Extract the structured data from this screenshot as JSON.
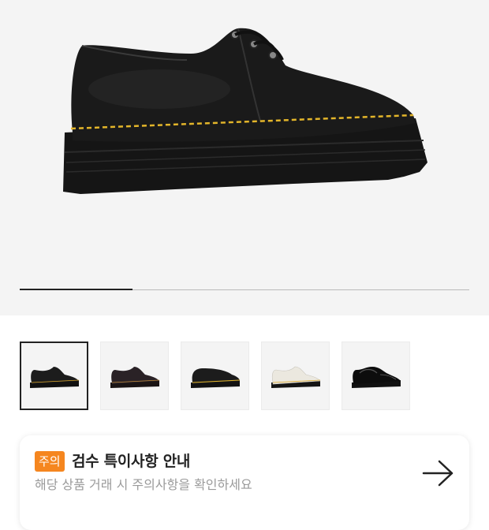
{
  "product": {
    "image_icon": "black-platform-derby-shoe",
    "gallery_progress": 0.25
  },
  "thumbnails": [
    {
      "icon": "black-shoe-thumbnail",
      "selected": true
    },
    {
      "icon": "dark-burgundy-shoe-thumbnail",
      "selected": false
    },
    {
      "icon": "black-shoe-yellow-stitch-thumbnail",
      "selected": false
    },
    {
      "icon": "white-shoe-thumbnail",
      "selected": false
    },
    {
      "icon": "black-patent-shoe-thumbnail",
      "selected": false
    }
  ],
  "notice": {
    "badge": "주의",
    "title": "검수 특이사항 안내",
    "subtitle": "해당 상품 거래 시 주의사항을 확인하세요",
    "arrow_icon": "arrow-right-icon"
  },
  "colors": {
    "accent": "#f5861f",
    "hero_background": "#f4f4f4"
  }
}
